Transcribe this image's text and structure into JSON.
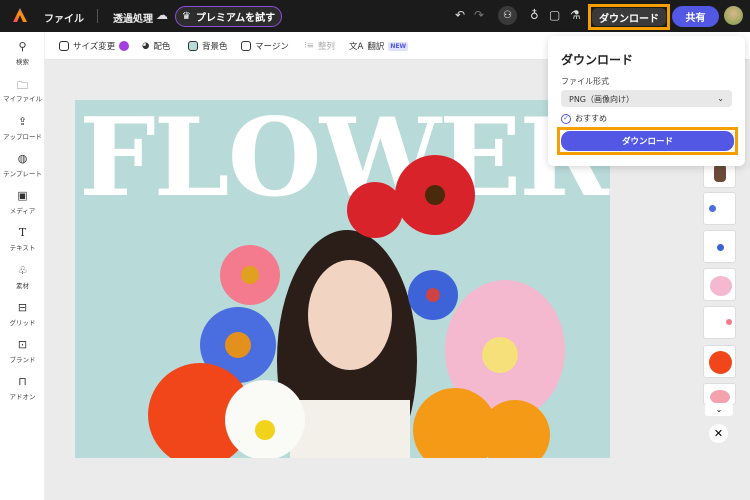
{
  "topbar": {
    "file": "ファイル",
    "doc_title": "透過処理",
    "premium": "プレミアムを試す",
    "download": "ダウンロード",
    "share": "共有",
    "icons": [
      "undo-icon",
      "redo-icon",
      "add-user-icon",
      "lightbulb-icon",
      "comment-icon",
      "flask-icon"
    ]
  },
  "sidebar": {
    "items": [
      {
        "label": "検索",
        "icon": "search-icon"
      },
      {
        "label": "マイファイル",
        "icon": "folder-icon"
      },
      {
        "label": "アップロード",
        "icon": "upload-icon"
      },
      {
        "label": "テンプレート",
        "icon": "template-icon"
      },
      {
        "label": "メディア",
        "icon": "media-icon"
      },
      {
        "label": "テキスト",
        "icon": "text-icon"
      },
      {
        "label": "素材",
        "icon": "elements-icon"
      },
      {
        "label": "グリッド",
        "icon": "grid-icon"
      },
      {
        "label": "ブランド",
        "icon": "brand-icon"
      },
      {
        "label": "アドオン",
        "icon": "addon-icon"
      }
    ]
  },
  "toolbar": {
    "resize": "サイズ変更",
    "color": "配色",
    "background": "背景色",
    "margin": "マージン",
    "align": "整列",
    "translate": "翻訳",
    "new_badge": "NEW"
  },
  "canvas": {
    "headline": "FLOWER",
    "background": "#b8dbd9"
  },
  "download_panel": {
    "title": "ダウンロード",
    "format_label": "ファイル形式",
    "format_value": "PNG（画像向け）",
    "recommended": "おすすめ",
    "button": "ダウンロード"
  },
  "colors": {
    "accent": "#5258e4",
    "highlight": "#f5a000",
    "topbar": "#1b1b1b"
  }
}
